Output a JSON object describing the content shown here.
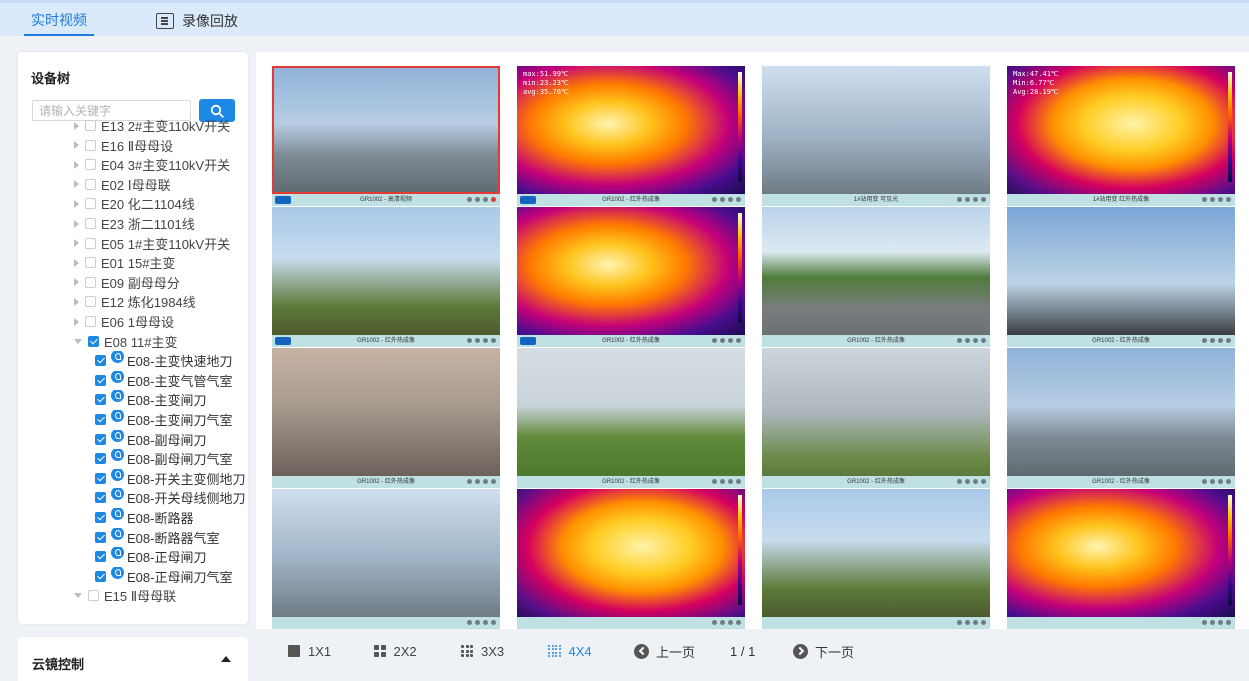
{
  "tabs": {
    "live": "实时视频",
    "playback": "录像回放"
  },
  "device_tree": {
    "title": "设备树",
    "search_placeholder": "请输入关键字",
    "nodes": [
      {
        "label": "E13 2#主变110kV开关",
        "expanded": false,
        "checked": false
      },
      {
        "label": "E16 Ⅱ母母设",
        "expanded": false,
        "checked": false
      },
      {
        "label": "E04 3#主变110kV开关",
        "expanded": false,
        "checked": false
      },
      {
        "label": "E02 Ⅰ母母联",
        "expanded": false,
        "checked": false
      },
      {
        "label": "E20 化二1104线",
        "expanded": false,
        "checked": false
      },
      {
        "label": "E23 浙二1101线",
        "expanded": false,
        "checked": false
      },
      {
        "label": "E05 1#主变110kV开关",
        "expanded": false,
        "checked": false
      },
      {
        "label": "E01 15#主变",
        "expanded": false,
        "checked": false
      },
      {
        "label": "E09 副母母分",
        "expanded": false,
        "checked": false
      },
      {
        "label": "E12 炼化1984线",
        "expanded": false,
        "checked": false
      },
      {
        "label": "E06 1母母设",
        "expanded": false,
        "checked": false
      },
      {
        "label": "E08 11#主变",
        "expanded": true,
        "checked": true
      }
    ],
    "children": [
      "E08-主变快速地刀",
      "E08-主变气管气室",
      "E08-主变闸刀",
      "E08-主变闸刀气室",
      "E08-副母闸刀",
      "E08-副母闸刀气室",
      "E08-开关主变侧地刀",
      "E08-开关母线侧地刀",
      "E08-断路器",
      "E08-断路器气室",
      "E08-正母闸刀",
      "E08-正母闸刀气室"
    ],
    "last_node": {
      "label": "E15 Ⅱ母母联",
      "expanded": true,
      "checked": false
    }
  },
  "ptz": {
    "title": "云镜控制"
  },
  "videos": [
    {
      "caption": "GR1002 - 高清视频",
      "kind": "visible",
      "selected": true
    },
    {
      "caption": "GR1002 - 红外热成像",
      "kind": "thermal",
      "osd": [
        "max:51.99℃",
        "min:23.23℃",
        "avg:35.76℃"
      ]
    },
    {
      "caption": "1#站用变 可见光",
      "kind": "visible"
    },
    {
      "caption": "1#站用变 红外热成像",
      "kind": "thermal",
      "osd": [
        "Max:47.41℃",
        "Min:6.77℃",
        "Avg:28.19℃"
      ]
    },
    {
      "caption": "GR1002 - 红外热成像",
      "kind": "visible"
    },
    {
      "caption": "GR1002 - 红外热成像",
      "kind": "thermal"
    },
    {
      "caption": "GR1002 - 红外热成像",
      "kind": "visible"
    },
    {
      "caption": "GR1002 - 红外热成像",
      "kind": "visible"
    },
    {
      "caption": "GR1002 - 红外热成像",
      "kind": "visible"
    },
    {
      "caption": "GR1002 - 红外热成像",
      "kind": "visible"
    },
    {
      "caption": "GR1002 - 红外热成像",
      "kind": "visible"
    },
    {
      "caption": "GR1002 - 红外热成像",
      "kind": "visible"
    },
    {
      "caption": "",
      "kind": "visible"
    },
    {
      "caption": "",
      "kind": "thermal"
    },
    {
      "caption": "",
      "kind": "visible"
    },
    {
      "caption": "",
      "kind": "thermal"
    }
  ],
  "layout": {
    "opt1": "1X1",
    "opt2": "2X2",
    "opt3": "3X3",
    "opt4": "4X4",
    "active": "4X4"
  },
  "pager": {
    "prev": "上一页",
    "page": "1 / 1",
    "next": "下一页"
  },
  "colors": {
    "accent": "#1e88e5",
    "selected_border": "#e53935",
    "caption_bar": "#bfe1e4"
  }
}
